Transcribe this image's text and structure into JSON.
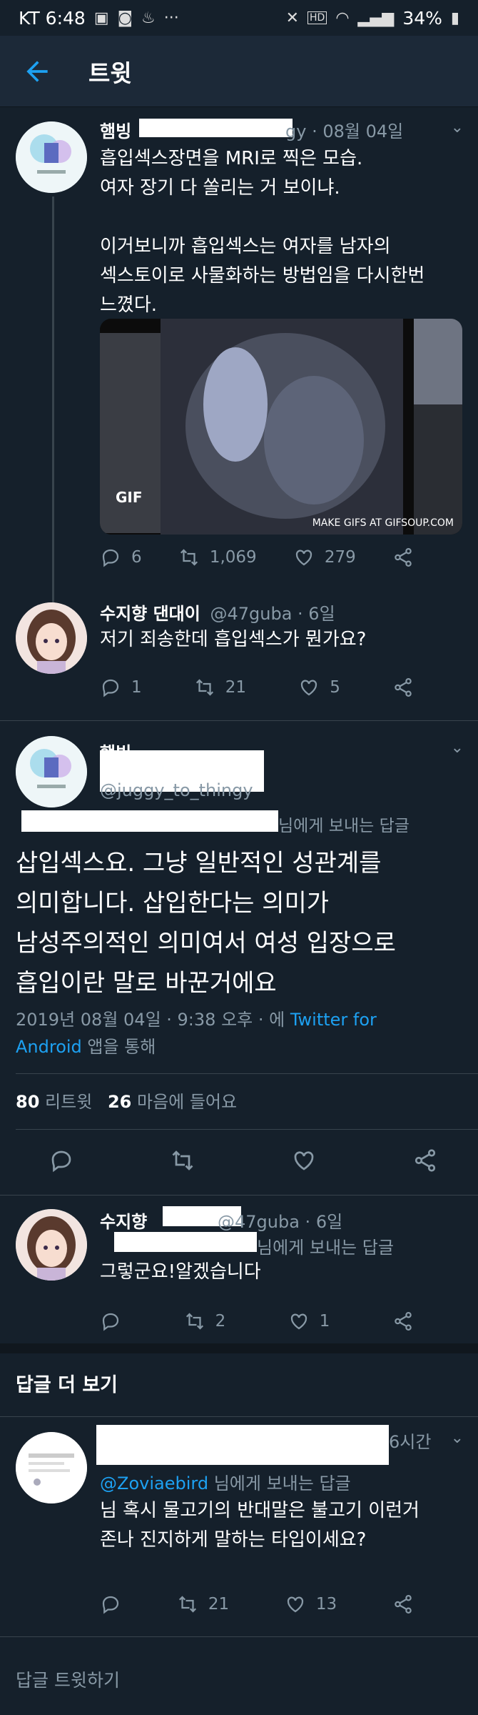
{
  "status_bar": {
    "carrier_time": "KT 6:48",
    "battery": "34%"
  },
  "header": {
    "title": "트윗"
  },
  "tweet1": {
    "name": "햄빙",
    "handle_tail": "gy · 08월 04일",
    "lines": [
      "흡입섹스장면을 MRI로 찍은 모습.",
      "여자 장기 다 쏠리는 거 보이냐.",
      "",
      "이거보니까 흡입섹스는 여자를 남자의",
      "섹스토이로 사물화하는 방법임을 다시한번",
      "느꼈다."
    ],
    "media_badge": "GIF",
    "media_watermark": "MAKE GIFS AT GIFSOUP.COM",
    "replies": "6",
    "retweets": "1,069",
    "likes": "279"
  },
  "tweet2": {
    "name": "수지향 댄대이",
    "handle_tail": "@47guba · 6일",
    "text": "저기 죄송한데 흡입섹스가 뭔가요?",
    "replies": "1",
    "retweets": "21",
    "likes": "5"
  },
  "main_tweet": {
    "name": "햄빙",
    "handle": "@juggy_to_thingy",
    "reply_to_suffix": "님에게 보내는 답글",
    "lines": [
      "삽입섹스요. 그냥 일반적인 성관계를",
      "의미합니다. 삽입한다는 의미가",
      "남성주의적인 의미여서 여성 입장으로",
      "흡입이란 말로 바꾼거에요"
    ],
    "meta_prefix": "2019년 08월 04일 · 9:38 오후 · 에 ",
    "meta_client_a": "Twitter for",
    "meta_client_b": "Android",
    "meta_suffix": " 앱을 통해",
    "retweets_count": "80",
    "retweets_label": "리트윗",
    "likes_count": "26",
    "likes_label": "마음에 들어요"
  },
  "tweet3": {
    "name": "수지향",
    "handle_tail": "@47guba · 6일",
    "reply_to_suffix": "님에게 보내는 답글",
    "text": "그렇군요!알겠습니다",
    "retweets": "2",
    "likes": "1"
  },
  "more_replies": {
    "title": "답글 더 보기"
  },
  "tweet4": {
    "time": "6시간",
    "reply_to_prefix": "@Zoviaebird",
    "reply_to_suffix": "님에게 보내는 답글",
    "lines": [
      "님 혹시 물고기의 반대말은 불고기 이런거",
      "존나 진지하게 말하는 타입이세요?"
    ],
    "retweets": "21",
    "likes": "13"
  },
  "composer": {
    "placeholder": "답글 트윗하기"
  },
  "colors": {
    "background": "#15202b",
    "accent": "#1da1f2",
    "secondary_text": "#8899a6"
  }
}
